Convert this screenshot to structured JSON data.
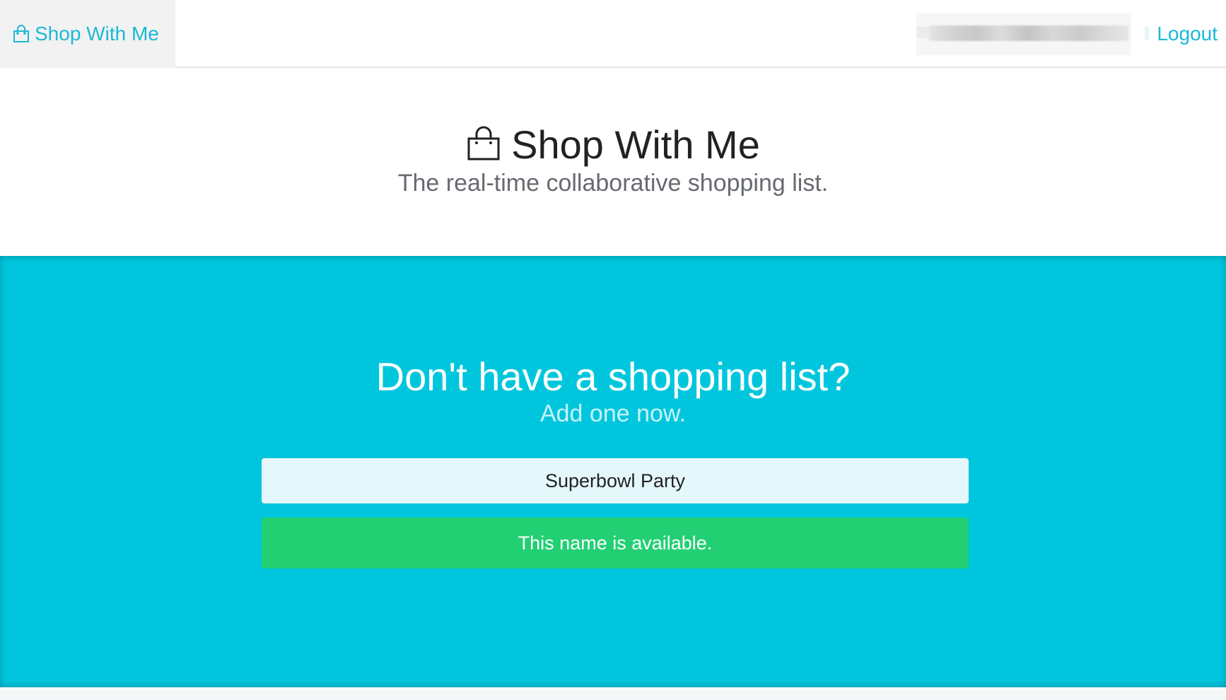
{
  "navbar": {
    "brand_label": "Shop With Me",
    "brand_icon": "shopping-bag-icon",
    "user_name_redacted": "",
    "logout_label": "Logout"
  },
  "hero": {
    "title": "Shop With Me",
    "title_icon": "shopping-bag-icon",
    "subtitle": "The real-time collaborative shopping list."
  },
  "create_list": {
    "heading": "Don't have a shopping list?",
    "subheading": "Add one now.",
    "input_value": "Superbowl Party",
    "status_message": "This name is available."
  },
  "colors": {
    "accent": "#1bb8d8",
    "band_background": "#00c6dd",
    "success": "#22d073",
    "input_background": "#e4f8fc"
  }
}
